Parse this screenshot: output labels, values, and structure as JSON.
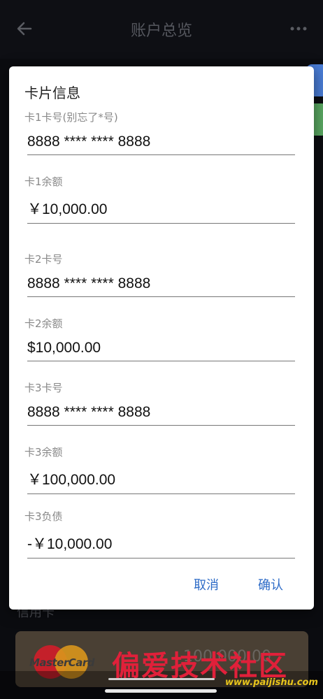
{
  "header": {
    "title": "账户总览"
  },
  "background": {
    "section_label": "信用卡",
    "card_brand": "MasterCard",
    "card_amount": "100,000.00"
  },
  "dialog": {
    "title": "卡片信息",
    "fields": [
      {
        "label": "卡1卡号(别忘了*号)",
        "value": "8888 **** **** 8888"
      },
      {
        "label": "卡1余额",
        "value": "￥10,000.00"
      },
      {
        "label": "卡2卡号",
        "value": "8888 **** **** 8888"
      },
      {
        "label": "卡2余额",
        "value": "$10,000.00"
      },
      {
        "label": "卡3卡号",
        "value": "8888 **** **** 8888"
      },
      {
        "label": "卡3余额",
        "value": "￥100,000.00"
      },
      {
        "label": "卡3负债",
        "value": "-￥10,000.00"
      }
    ],
    "cancel_label": "取消",
    "confirm_label": "确认"
  },
  "watermark": {
    "text": "偏爱技术社区",
    "url": "www.paijishu.com"
  },
  "colors": {
    "accent": "#2d6bc7",
    "background": "#121318",
    "dialog": "#ffffff"
  }
}
